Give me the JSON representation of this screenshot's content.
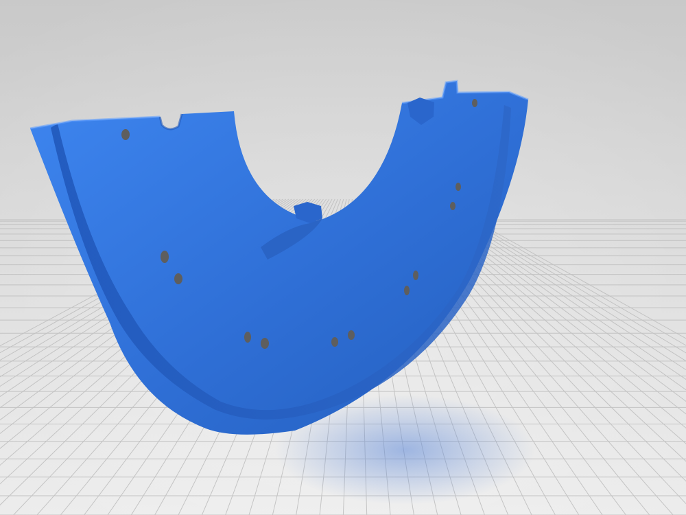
{
  "scene": {
    "subject": "3d-printed-part-render",
    "colors": {
      "background_top": "#c7c7c7",
      "background_bottom": "#e7e7e7",
      "grid_line": "#bcbcbc",
      "part_main": "#2f6fd6",
      "part_dark": "#1f56b8",
      "part_light": "#3f82e8",
      "part_shadow": "#7f9fd8",
      "hole": "#5b5b5b"
    }
  }
}
